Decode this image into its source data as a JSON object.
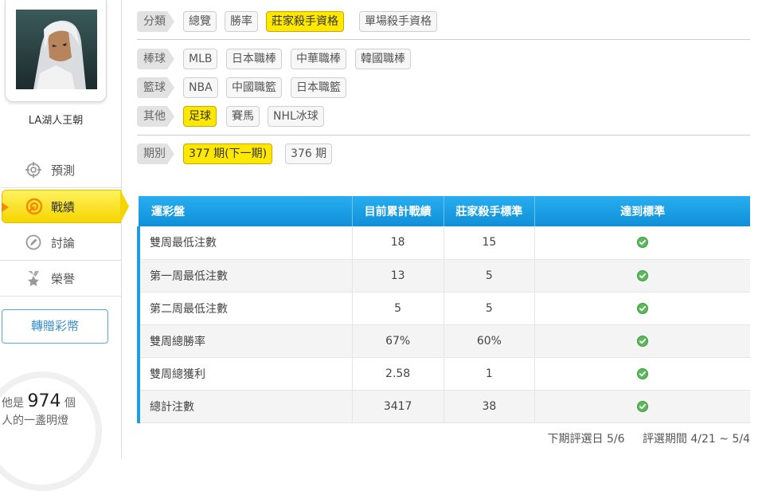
{
  "user": {
    "name": "LA湖人王朝"
  },
  "sidebar": {
    "items": [
      {
        "label": "預測",
        "icon": "target-icon"
      },
      {
        "label": "戰績",
        "icon": "record-target-icon",
        "active": true
      },
      {
        "label": "討論",
        "icon": "chat-pencil-icon"
      },
      {
        "label": "榮譽",
        "icon": "medal-icon"
      }
    ],
    "gift_button": "轉贈彩幣",
    "lamp": {
      "prefix": "他是",
      "count": "974",
      "unit": "個",
      "suffix": "人的一盞明燈"
    }
  },
  "filters": {
    "category": {
      "label": "分類",
      "options": [
        "總覽",
        "勝率",
        "莊家殺手資格",
        "單場殺手資格"
      ],
      "active": "莊家殺手資格"
    },
    "baseball": {
      "label": "棒球",
      "options": [
        "MLB",
        "日本職棒",
        "中華職棒",
        "韓國職棒"
      ]
    },
    "basketball": {
      "label": "籃球",
      "options": [
        "NBA",
        "中國職籃",
        "日本職籃"
      ]
    },
    "other": {
      "label": "其他",
      "options": [
        "足球",
        "賽馬",
        "NHL冰球"
      ],
      "active": "足球"
    },
    "period": {
      "label": "期別",
      "options": [
        "377 期(下一期)",
        "376 期"
      ],
      "active": "377 期(下一期)"
    }
  },
  "table": {
    "headers": [
      "運彩盤",
      "目前累計戰績",
      "莊家殺手標準",
      "達到標準"
    ],
    "rows": [
      {
        "name": "雙周最低注數",
        "current": "18",
        "standard": "15",
        "met": true
      },
      {
        "name": "第一周最低注數",
        "current": "13",
        "standard": "5",
        "met": true
      },
      {
        "name": "第二周最低注數",
        "current": "5",
        "standard": "5",
        "met": true
      },
      {
        "name": "雙周總勝率",
        "current": "67%",
        "standard": "60%",
        "met": true
      },
      {
        "name": "雙周總獲利",
        "current": "2.58",
        "standard": "1",
        "met": true
      },
      {
        "name": "總計注數",
        "current": "3417",
        "standard": "38",
        "met": true
      }
    ]
  },
  "footer": {
    "next_date": "下期評選日 5/6",
    "period_range": "評選期間 4/21 ~ 5/4"
  },
  "colors": {
    "accent_yellow": "#ffe800",
    "table_header_blue": "#1ea3e8",
    "check_green": "#5cb85c",
    "gift_blue": "#3a8fc8"
  }
}
